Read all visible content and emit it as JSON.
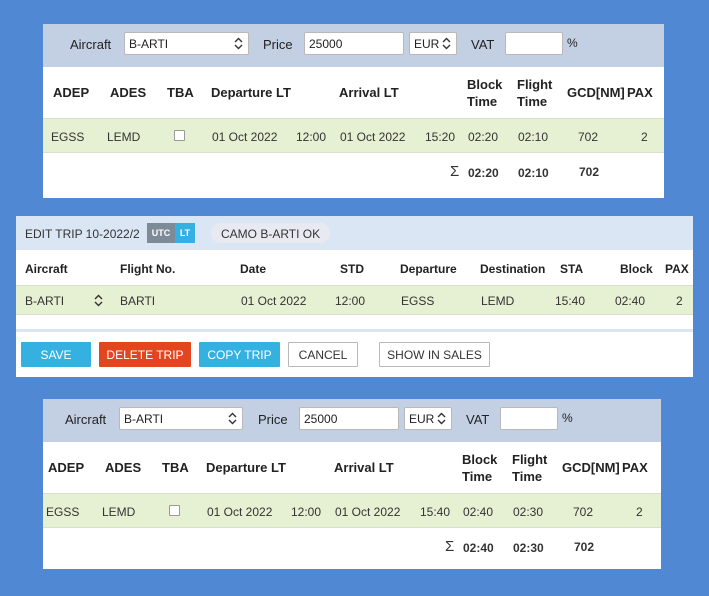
{
  "quote1": {
    "aircraft_label": "Aircraft",
    "aircraft_value": "B-ARTI",
    "price_label": "Price",
    "price_value": "25000",
    "currency": "EUR",
    "vat_label": "VAT",
    "vat_value": "",
    "percent": "%",
    "headers": {
      "adep": "ADEP",
      "ades": "ADES",
      "tba": "TBA",
      "dep": "Departure LT",
      "arr": "Arrival LT",
      "block1": "Block",
      "block2": "Time",
      "flight1": "Flight",
      "flight2": "Time",
      "gcd": "GCD[NM]",
      "pax": "PAX"
    },
    "row": {
      "adep": "EGSS",
      "ades": "LEMD",
      "dep_date": "01 Oct 2022",
      "dep_time": "12:00",
      "arr_date": "01 Oct 2022",
      "arr_time": "15:20",
      "block": "02:20",
      "flight": "02:10",
      "gcd": "702",
      "pax": "2"
    },
    "totals": {
      "sigma": "Σ",
      "block": "02:20",
      "flight": "02:10",
      "gcd": "702"
    }
  },
  "edit_trip": {
    "title": "EDIT TRIP 10-2022/2",
    "utc": "UTC",
    "lt": "LT",
    "camo": "CAMO B-ARTI OK",
    "headers": {
      "aircraft": "Aircraft",
      "flight_no": "Flight No.",
      "date": "Date",
      "std": "STD",
      "departure": "Departure",
      "destination": "Destination",
      "sta": "STA",
      "block": "Block",
      "pax": "PAX"
    },
    "row": {
      "aircraft": "B-ARTI",
      "flight_no": "BARTI",
      "date": "01 Oct 2022",
      "std": "12:00",
      "departure": "EGSS",
      "destination": "LEMD",
      "sta": "15:40",
      "block": "02:40",
      "pax": "2"
    },
    "buttons": {
      "save": "SAVE",
      "delete": "DELETE TRIP",
      "copy": "COPY TRIP",
      "cancel": "CANCEL",
      "show_in_sales": "SHOW IN SALES"
    },
    "colors": {
      "utc": "#7d8a98",
      "lt": "#35b1e1",
      "save": "#35b1e1",
      "delete": "#e2461f"
    }
  },
  "quote2": {
    "aircraft_label": "Aircraft",
    "aircraft_value": "B-ARTI",
    "price_label": "Price",
    "price_value": "25000",
    "currency": "EUR",
    "vat_label": "VAT",
    "vat_value": "",
    "percent": "%",
    "headers": {
      "adep": "ADEP",
      "ades": "ADES",
      "tba": "TBA",
      "dep": "Departure LT",
      "arr": "Arrival LT",
      "block1": "Block",
      "block2": "Time",
      "flight1": "Flight",
      "flight2": "Time",
      "gcd": "GCD[NM]",
      "pax": "PAX"
    },
    "row": {
      "adep": "EGSS",
      "ades": "LEMD",
      "dep_date": "01 Oct 2022",
      "dep_time": "12:00",
      "arr_date": "01 Oct 2022",
      "arr_time": "15:40",
      "block": "02:40",
      "flight": "02:30",
      "gcd": "702",
      "pax": "2"
    },
    "totals": {
      "sigma": "Σ",
      "block": "02:40",
      "flight": "02:30",
      "gcd": "702"
    }
  }
}
